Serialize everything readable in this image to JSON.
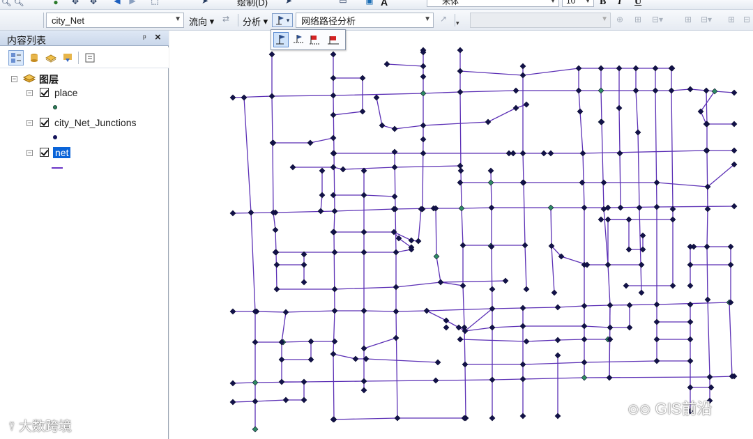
{
  "toolbar_top": {
    "draw_menu_label": "绘制(D)",
    "font_name": "宋体",
    "font_size": "10",
    "bold_label": "B",
    "italic_label": "I",
    "underline_label": "U",
    "font_color_label": "A"
  },
  "network_toolbar": {
    "network_dataset": "city_Net",
    "flow_menu": "流向",
    "analysis_menu": "分析",
    "analysis_layer": "网络路径分析"
  },
  "toc": {
    "title": "内容列表",
    "root_label": "图层",
    "layers": [
      {
        "name": "place",
        "checked": true,
        "symbol": "point",
        "color": "#2e7d5b"
      },
      {
        "name": "city_Net_Junctions",
        "checked": true,
        "symbol": "point",
        "color": "#14145a"
      },
      {
        "name": "net",
        "checked": true,
        "symbol": "line",
        "color": "#6a34c6",
        "selected": true
      }
    ]
  },
  "map": {
    "line_color": "#5b2fb5",
    "junction_color": "#12124a",
    "place_color": "#2e8b62"
  },
  "watermarks": {
    "left": "大数跨境",
    "right": "GIS前沿"
  }
}
